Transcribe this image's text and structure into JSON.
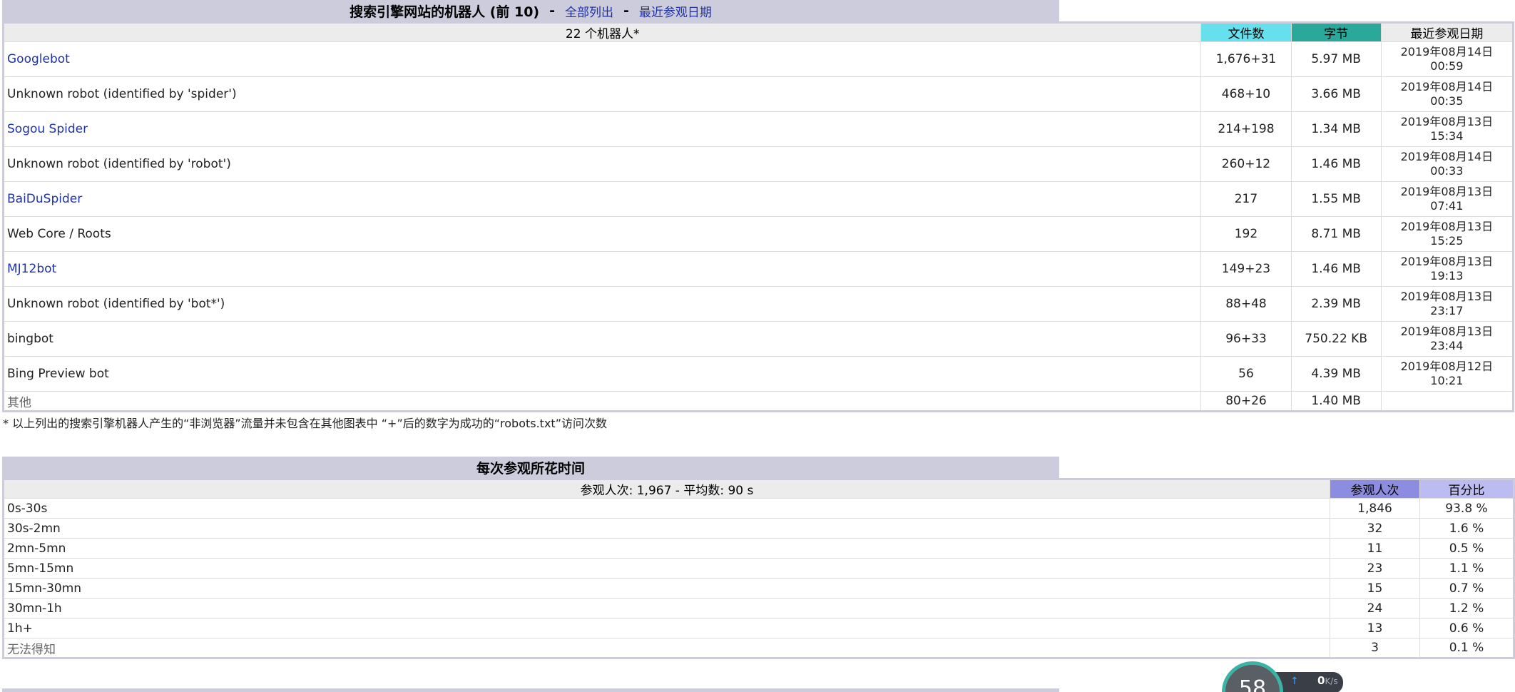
{
  "robots": {
    "title": "搜索引擎网站的机器人 (前 10)",
    "separator": "-",
    "link_all": "全部列出",
    "link_last": "最近参观日期",
    "header": {
      "count_label": "22 个机器人*",
      "col_files": "文件数",
      "col_bytes": "字节",
      "col_last": "最近参观日期"
    },
    "rows": [
      {
        "name": "Googlebot",
        "files": "1,676+31",
        "bytes": "5.97 MB",
        "date": "2019年08月14日",
        "time": "00:59"
      },
      {
        "name": "Unknown robot (identified by 'spider')",
        "files": "468+10",
        "bytes": "3.66 MB",
        "date": "2019年08月14日",
        "time": "00:35"
      },
      {
        "name": "Sogou Spider",
        "files": "214+198",
        "bytes": "1.34 MB",
        "date": "2019年08月13日",
        "time": "15:34"
      },
      {
        "name": "Unknown robot (identified by 'robot')",
        "files": "260+12",
        "bytes": "1.46 MB",
        "date": "2019年08月14日",
        "time": "00:33"
      },
      {
        "name": "BaiDuSpider",
        "files": "217",
        "bytes": "1.55 MB",
        "date": "2019年08月13日",
        "time": "07:41"
      },
      {
        "name": "Web Core / Roots",
        "files": "192",
        "bytes": "8.71 MB",
        "date": "2019年08月13日",
        "time": "15:25"
      },
      {
        "name": "MJ12bot",
        "files": "149+23",
        "bytes": "1.46 MB",
        "date": "2019年08月13日",
        "time": "19:13"
      },
      {
        "name": "Unknown robot (identified by 'bot*')",
        "files": "88+48",
        "bytes": "2.39 MB",
        "date": "2019年08月13日",
        "time": "23:17"
      },
      {
        "name": "bingbot",
        "files": "96+33",
        "bytes": "750.22 KB",
        "date": "2019年08月13日",
        "time": "23:44"
      },
      {
        "name": "Bing Preview bot",
        "files": "56",
        "bytes": "4.39 MB",
        "date": "2019年08月12日",
        "time": "10:21"
      }
    ],
    "other": {
      "name": "其他",
      "files": "80+26",
      "bytes": "1.40 MB"
    },
    "footnote": "* 以上列出的搜索引擎机器人产生的“非浏览器”流量并未包含在其他图表中 “+”后的数字为成功的“robots.txt”访问次数"
  },
  "duration": {
    "title": "每次参观所花时间",
    "header": {
      "summary": "参观人次: 1,967 - 平均数: 90 s",
      "col_visits": "参观人次",
      "col_percent": "百分比"
    },
    "rows": [
      {
        "range": "0s-30s",
        "visits": "1,846",
        "percent": "93.8 %"
      },
      {
        "range": "30s-2mn",
        "visits": "32",
        "percent": "1.6 %"
      },
      {
        "range": "2mn-5mn",
        "visits": "11",
        "percent": "0.5 %"
      },
      {
        "range": "5mn-15mn",
        "visits": "23",
        "percent": "1.1 %"
      },
      {
        "range": "15mn-30mn",
        "visits": "15",
        "percent": "0.7 %"
      },
      {
        "range": "30mn-1h",
        "visits": "24",
        "percent": "1.2 %"
      },
      {
        "range": "1h+",
        "visits": "13",
        "percent": "0.6 %"
      }
    ],
    "unknown": {
      "range": "无法得知",
      "visits": "3",
      "percent": "0.1 %"
    }
  },
  "widget": {
    "value": "58",
    "speed": "0",
    "unit": "K/s"
  },
  "colors": {
    "files_header": "#66e0ec",
    "bytes_header": "#2aa89a",
    "visits_header": "#8c8ce0",
    "percent_header": "#bcbcf0",
    "title_bar": "#ccccdd",
    "link": "#1f32a8"
  }
}
